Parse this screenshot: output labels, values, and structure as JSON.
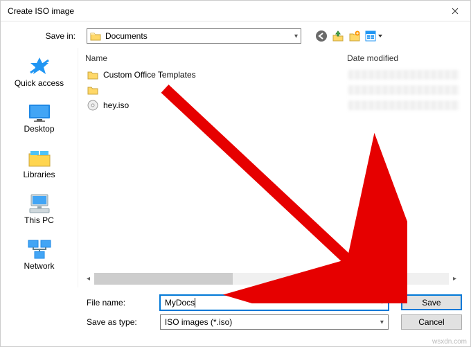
{
  "window": {
    "title": "Create ISO image"
  },
  "savein": {
    "label": "Save in:",
    "value": "Documents"
  },
  "columns": {
    "name": "Name",
    "date": "Date modified"
  },
  "sidebar": {
    "items": [
      {
        "label": "Quick access"
      },
      {
        "label": "Desktop"
      },
      {
        "label": "Libraries"
      },
      {
        "label": "This PC"
      },
      {
        "label": "Network"
      }
    ]
  },
  "files": [
    {
      "name": "Custom Office Templates",
      "kind": "folder",
      "date": ""
    },
    {
      "name": "",
      "kind": "folder",
      "date": ""
    },
    {
      "name": "hey.iso",
      "kind": "iso",
      "date": ""
    }
  ],
  "form": {
    "filename_label": "File name:",
    "filename_value": "MyDocs",
    "type_label": "Save as type:",
    "type_value": "ISO images (*.iso)",
    "save_label": "Save",
    "cancel_label": "Cancel"
  },
  "watermark": "wsxdn.com"
}
